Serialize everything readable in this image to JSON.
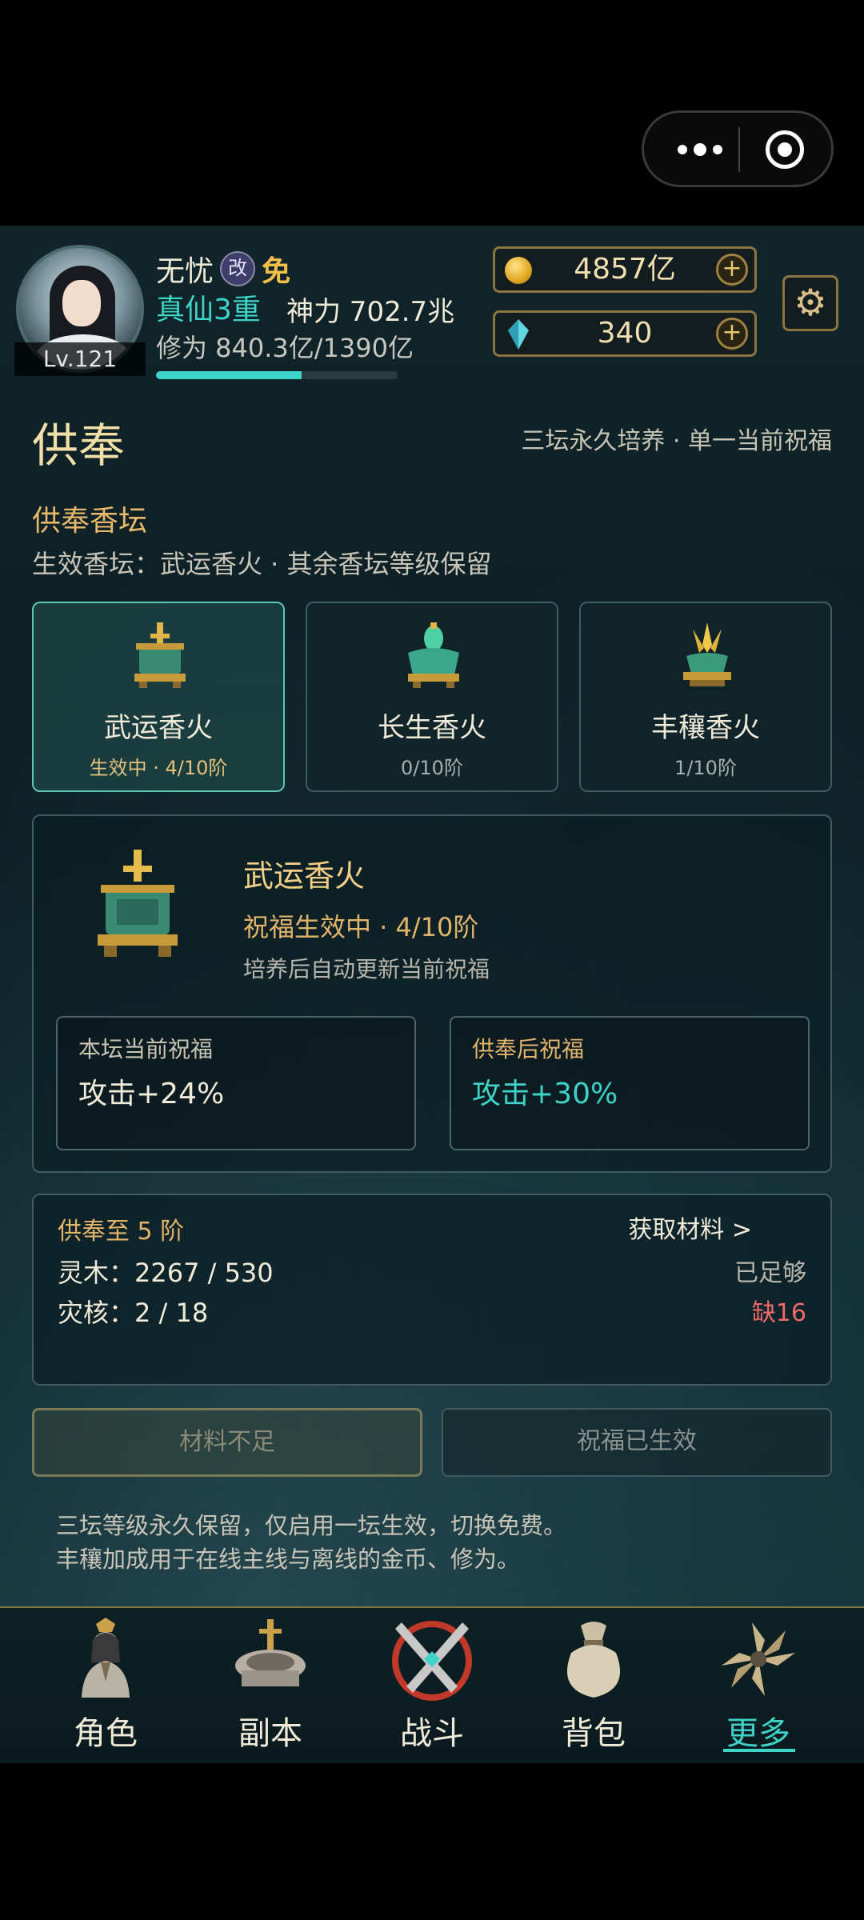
{
  "system": {
    "capsule_more_icon": "more-dots-icon",
    "capsule_close_icon": "target-circle-icon"
  },
  "player": {
    "level": "Lv.121",
    "name": "无忧",
    "badge_gai": "改",
    "badge_mian": "免",
    "realm": "真仙3重",
    "power": "神力 702.7兆",
    "cultivation": "修为 840.3亿/1390亿",
    "cultivation_progress": 0.604
  },
  "currency": {
    "gold": "4857亿",
    "gems": "340"
  },
  "page": {
    "title": "供奉",
    "subtitle": "三坛永久培养 · 单一当前祝福",
    "section_title": "供奉香坛",
    "section_sub": "生效香坛：武运香火 · 其余香坛等级保留"
  },
  "altars": [
    {
      "name": "武运香火",
      "status": "生效中 · 4/10阶",
      "active": true
    },
    {
      "name": "长生香火",
      "status": "0/10阶",
      "active": false
    },
    {
      "name": "丰穰香火",
      "status": "1/10阶",
      "active": false
    }
  ],
  "detail": {
    "name": "武运香火",
    "status": "祝福生效中 · 4/10阶",
    "note": "培养后自动更新当前祝福",
    "current_label": "本坛当前祝福",
    "current_value": "攻击+24%",
    "after_label": "供奉后祝福",
    "after_value": "攻击+30%"
  },
  "materials": {
    "header": "供奉至 5 阶",
    "get_link": "获取材料 >",
    "rows": [
      {
        "label": "灵木：2267 / 530",
        "status": "已足够"
      },
      {
        "label": "灾核：2 / 18",
        "status": "缺16"
      }
    ]
  },
  "buttons": {
    "insufficient": "材料不足",
    "blessed": "祝福已生效"
  },
  "footnotes": [
    "三坛等级永久保留，仅启用一坛生效，切换免费。",
    "丰穰加成用于在线主线与离线的金币、修为。"
  ],
  "tabs": [
    {
      "label": "角色",
      "icon": "character-icon"
    },
    {
      "label": "副本",
      "icon": "dungeon-icon"
    },
    {
      "label": "战斗",
      "icon": "battle-swords-icon"
    },
    {
      "label": "背包",
      "icon": "bag-icon"
    },
    {
      "label": "更多",
      "icon": "more-shuriken-icon",
      "active": true
    }
  ],
  "colors": {
    "accent": "#3ed3c8",
    "gold": "#e2b46a",
    "warning": "#ee6a6a"
  }
}
